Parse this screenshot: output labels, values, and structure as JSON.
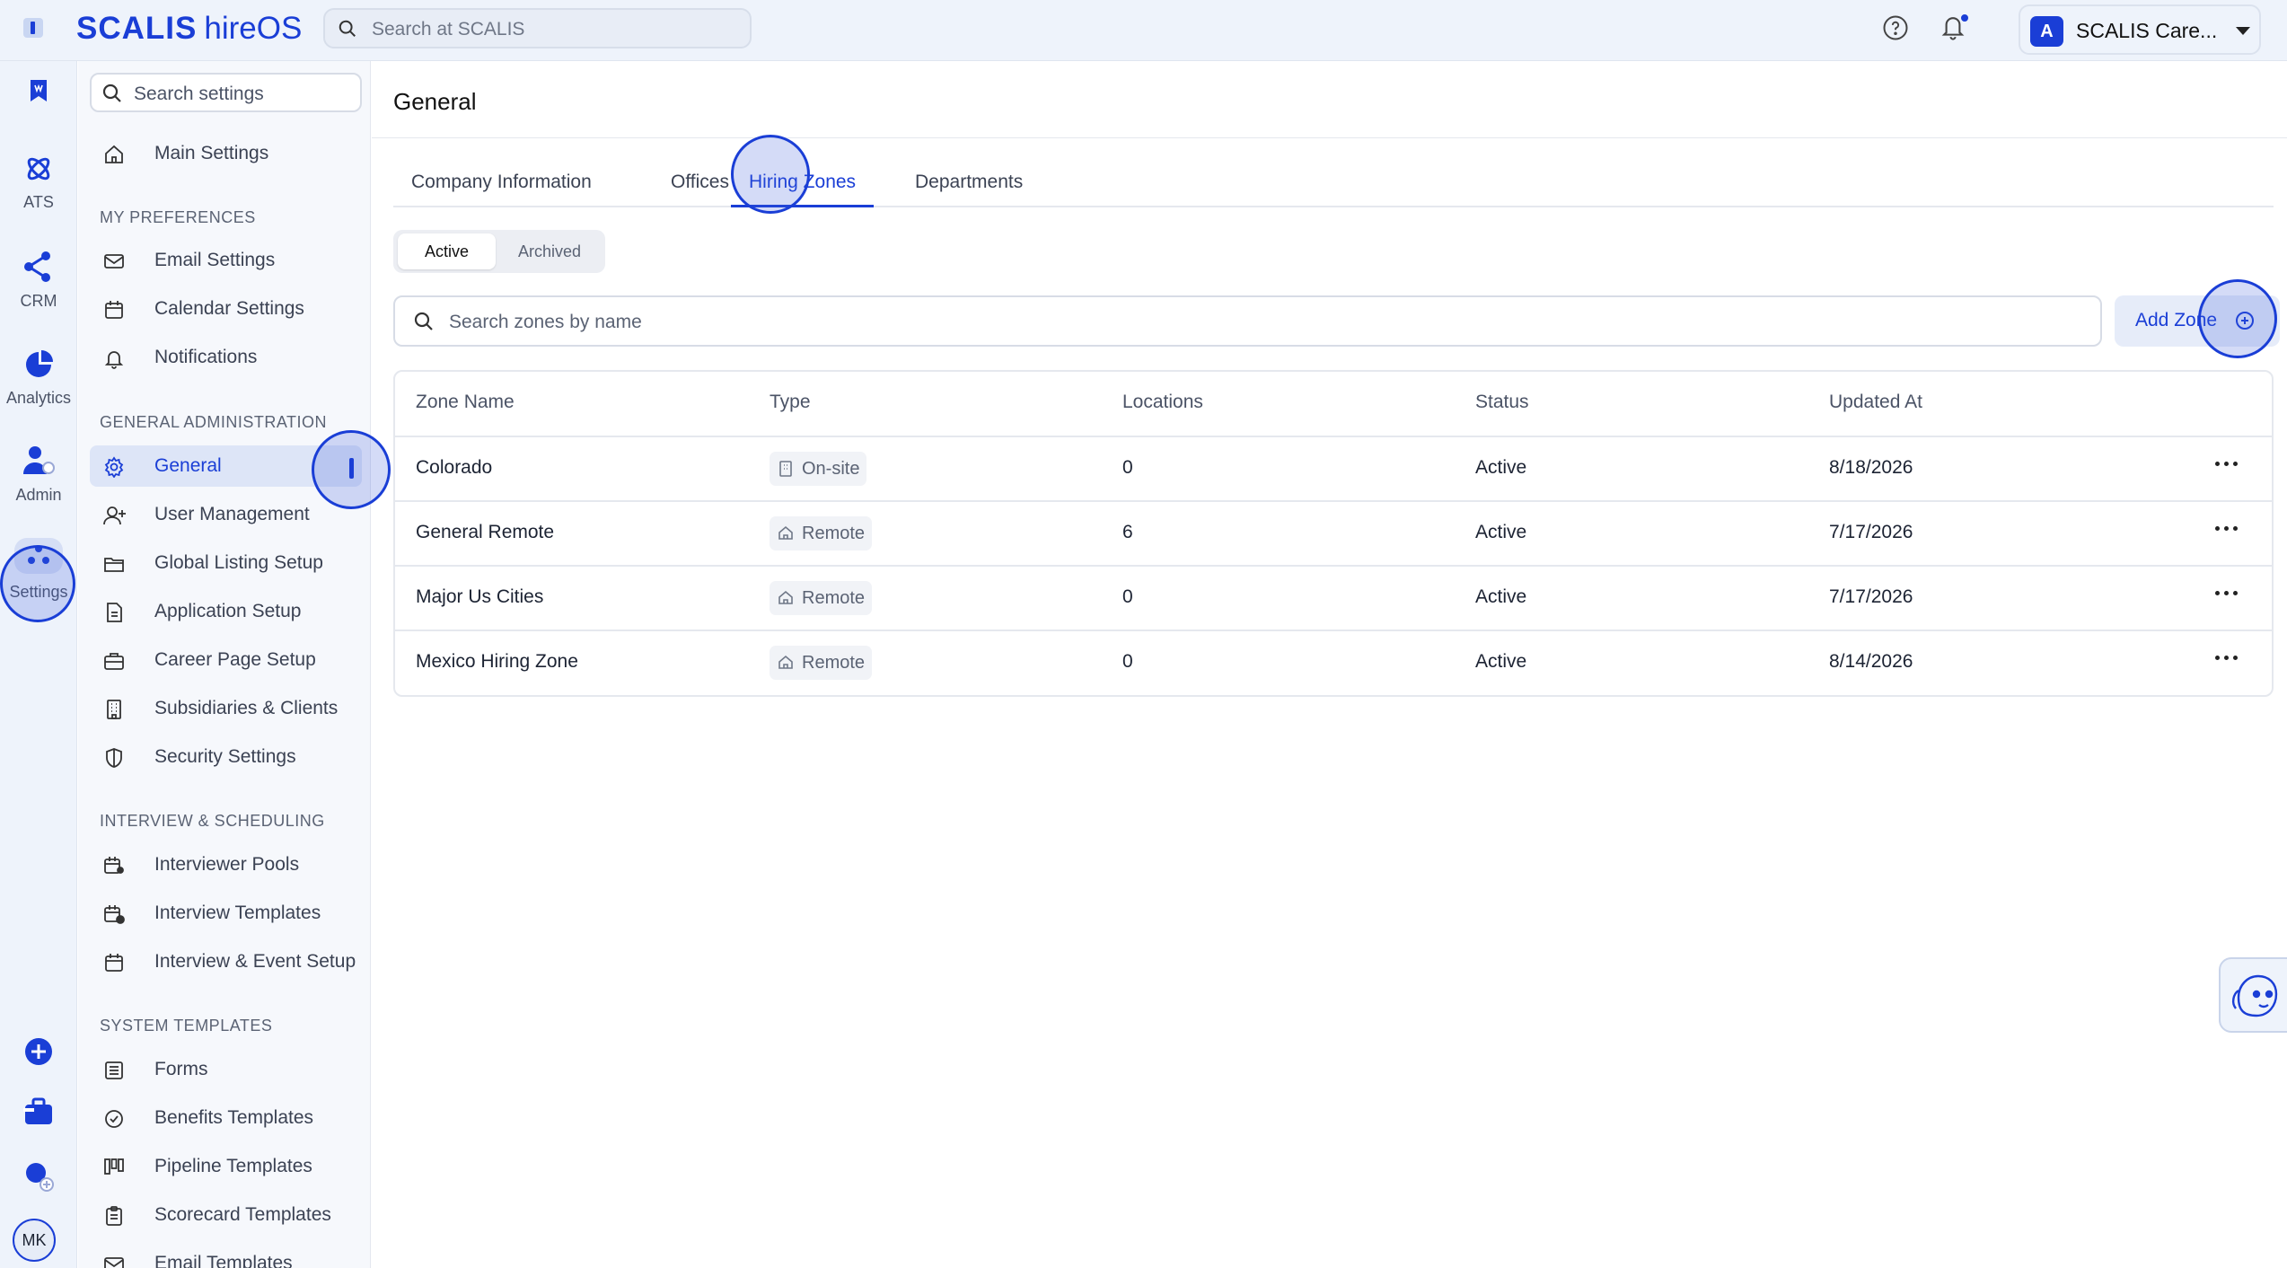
{
  "app": {
    "logo_main": "SCALIS",
    "logo_sub": "hireOS",
    "search_placeholder": "Search at SCALIS",
    "org_name": "SCALIS Care...",
    "org_initial": "A"
  },
  "rail": {
    "items": [
      {
        "label": ""
      },
      {
        "label": "ATS"
      },
      {
        "label": "CRM"
      },
      {
        "label": "Analytics"
      },
      {
        "label": "Admin"
      },
      {
        "label": "Settings"
      }
    ],
    "avatar_initials": "MK"
  },
  "settings_sidebar": {
    "search_placeholder": "Search settings",
    "main_settings": "Main Settings",
    "sections": [
      {
        "title": "MY PREFERENCES",
        "items": [
          "Email Settings",
          "Calendar Settings",
          "Notifications"
        ]
      },
      {
        "title": "GENERAL ADMINISTRATION",
        "items": [
          "General",
          "User Management",
          "Global Listing Setup",
          "Application Setup",
          "Career Page Setup",
          "Subsidiaries & Clients",
          "Security Settings"
        ]
      },
      {
        "title": "INTERVIEW & SCHEDULING",
        "items": [
          "Interviewer Pools",
          "Interview Templates",
          "Interview & Event Setup"
        ]
      },
      {
        "title": "SYSTEM TEMPLATES",
        "items": [
          "Forms",
          "Benefits Templates",
          "Pipeline Templates",
          "Scorecard Templates",
          "Email Templates"
        ]
      }
    ],
    "active_item": "General"
  },
  "main": {
    "title": "General",
    "tabs": [
      "Company Information",
      "Offices",
      "Hiring Zones",
      "Departments"
    ],
    "active_tab": "Hiring Zones",
    "segments": [
      "Active",
      "Archived"
    ],
    "active_segment": "Active",
    "zone_search_placeholder": "Search zones by name",
    "add_zone_label": "Add Zone",
    "table": {
      "columns": [
        "Zone Name",
        "Type",
        "Locations",
        "Status",
        "Updated At"
      ],
      "rows": [
        {
          "name": "Colorado",
          "type": "On-site",
          "locations": "0",
          "status": "Active",
          "updated": "8/18/2026"
        },
        {
          "name": "General Remote",
          "type": "Remote",
          "locations": "6",
          "status": "Active",
          "updated": "7/17/2026"
        },
        {
          "name": "Major Us Cities",
          "type": "Remote",
          "locations": "0",
          "status": "Active",
          "updated": "7/17/2026"
        },
        {
          "name": "Mexico Hiring Zone",
          "type": "Remote",
          "locations": "0",
          "status": "Active",
          "updated": "8/14/2026"
        }
      ]
    }
  },
  "colors": {
    "accent": "#1a3ed6",
    "rail_bg": "#eef3fb",
    "sidebar_bg": "#f6f8fc",
    "active_nav_bg": "#dde5f7"
  },
  "icons": {
    "rail": [
      "brand-icon",
      "bookmark-icon",
      "ats-icon",
      "crm-icon",
      "analytics-icon",
      "admin-icon",
      "settings-icon",
      "plus-circle-icon",
      "briefcase-add-icon",
      "user-add-icon"
    ],
    "sidebar": [
      "home-icon",
      "mail-icon",
      "calendar-icon",
      "bell-icon",
      "gear-icon",
      "user-plus-icon",
      "folder-icon",
      "document-icon",
      "briefcase-icon",
      "building-icon",
      "shield-icon",
      "calendar-users-icon",
      "calendar-clock-icon",
      "calendar-icon",
      "list-icon",
      "badge-check-icon",
      "pipeline-icon",
      "clipboard-icon",
      "mail-template-icon"
    ],
    "type_onsite": "building-icon",
    "type_remote": "home-icon"
  }
}
